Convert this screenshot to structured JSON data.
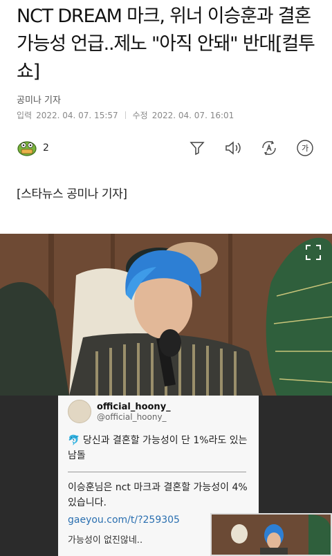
{
  "article": {
    "title": "NCT DREAM 마크, 위너 이승훈과 결혼 가능성 언급..제노 \"아직 안돼\" 반대[컬투쇼]",
    "reporter": "공미나 기자",
    "published_label": "입력",
    "published": "2022. 04. 07. 15:57",
    "modified_label": "수정",
    "modified": "2022. 04. 07. 16:01",
    "lede": "[스타뉴스 공미나 기자]"
  },
  "toolbar": {
    "reaction_count": "2",
    "font_size_label": "가"
  },
  "photo": {
    "tweet_name": "official_hoony_",
    "tweet_handle": "@official_hoony_",
    "question": "🐬 당신과 결혼할 가능성이 단 1%라도 있는 남돌",
    "answer": "이승훈님은 nct 마크과 결혼할 가능성이 4% 있습니다.",
    "link": "gaeyou.com/t/?259305",
    "caption_end": "가능성이 없진않네.."
  },
  "colors": {
    "text": "#111111",
    "meta": "#888888",
    "link": "#2a6fb0"
  }
}
